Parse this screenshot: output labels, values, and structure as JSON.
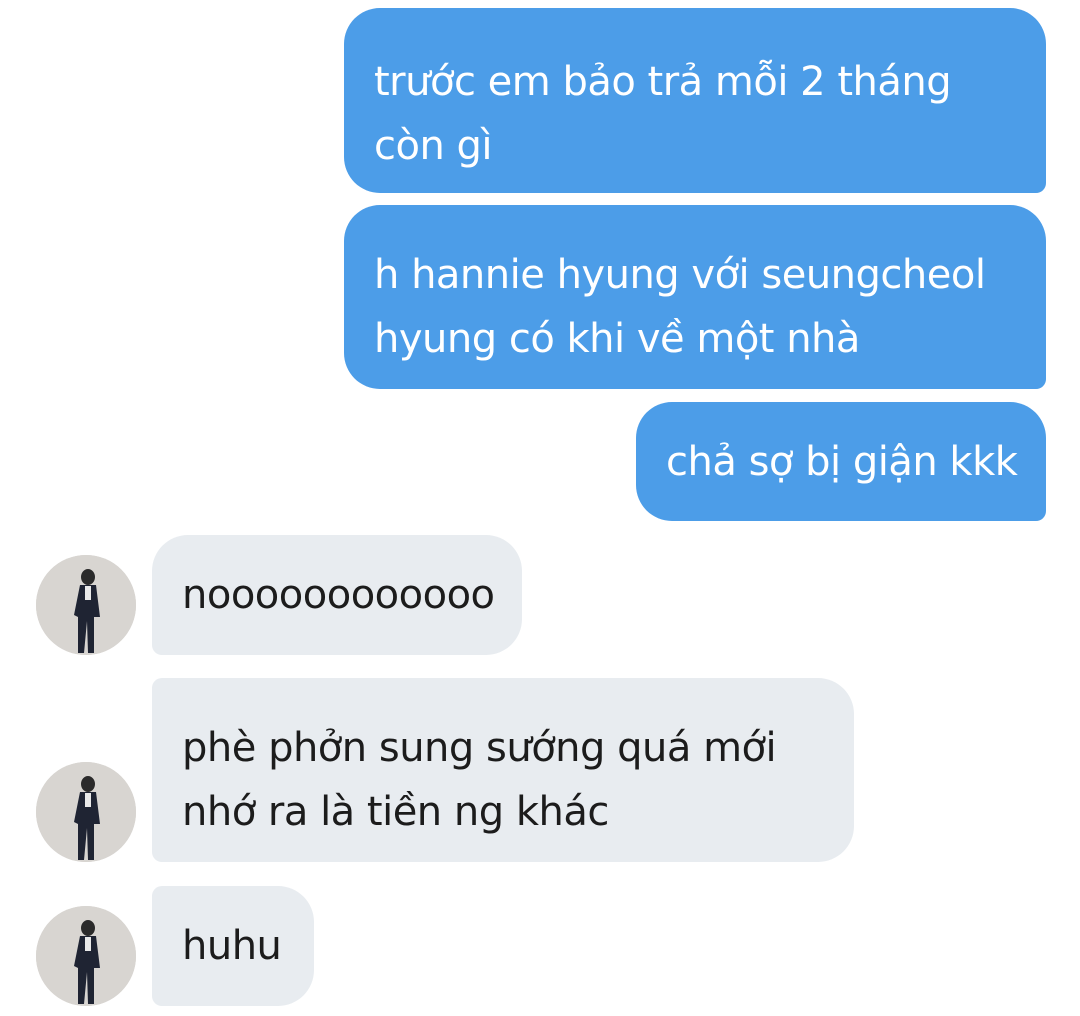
{
  "thread": {
    "messages": [
      {
        "direction": "sent",
        "text": "trước em bảo trả mỗi 2 tháng\ncòn gì"
      },
      {
        "direction": "sent",
        "text": "h hannie hyung với seungcheol\nhyung có khi về một nhà"
      },
      {
        "direction": "sent",
        "text": "chả sợ bị giận kkk"
      },
      {
        "direction": "received",
        "text": "noooooooooooo"
      },
      {
        "direction": "received",
        "text": "phè phởn sung sướng quá mới\nnhớ ra là tiền ng khác"
      },
      {
        "direction": "received",
        "text": "huhu"
      }
    ]
  },
  "contact": {
    "avatar_icon": "person-in-suit-photo-avatar"
  },
  "colors": {
    "sent_bubble": "#4c9de8",
    "received_bubble": "#e8ecf0",
    "sent_text": "#ffffff",
    "received_text": "#1c1c1c"
  }
}
